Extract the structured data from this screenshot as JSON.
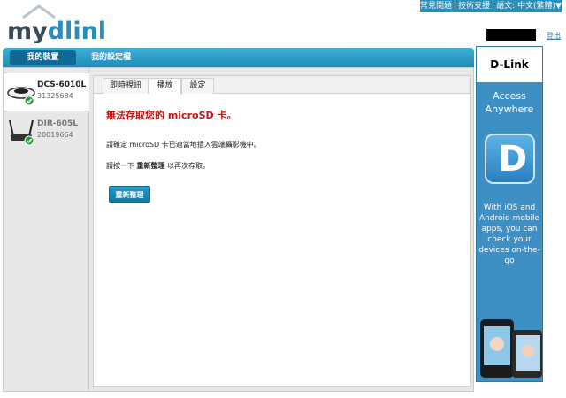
{
  "top_links": {
    "faq": "常見問題",
    "support": "技術支援",
    "language": "語文: 中文(繁體)▼"
  },
  "logo": {
    "text": "mydlink"
  },
  "user": {
    "logout": "登出"
  },
  "nav": {
    "my_devices": "我的裝置",
    "my_settings": "我的設定檔"
  },
  "devices": [
    {
      "name": "DCS-6010L",
      "id": "31325684",
      "status": "online"
    },
    {
      "name": "DIR-605L",
      "id": "20019664",
      "status": "online"
    }
  ],
  "tabs": {
    "live": "即時視訊",
    "playback": "播放",
    "settings": "設定"
  },
  "error": {
    "title": "無法存取您的 microSD 卡。",
    "line1": "請確定 microSD 卡已適當地插入雲端攝影機中。",
    "line2_pre": "請按一下 ",
    "line2_bold": "重新整理",
    "line2_post": " 以再次存取。",
    "button": "重新整理"
  },
  "ad": {
    "brand": "D-Link",
    "headline": "Access Anywhere",
    "body": "With iOS and Android mobile apps, you can check your devices on-the-go"
  },
  "colors": {
    "accent": "#1e8cb8",
    "error": "#cc1111",
    "status_ok": "#2a9d3a"
  }
}
